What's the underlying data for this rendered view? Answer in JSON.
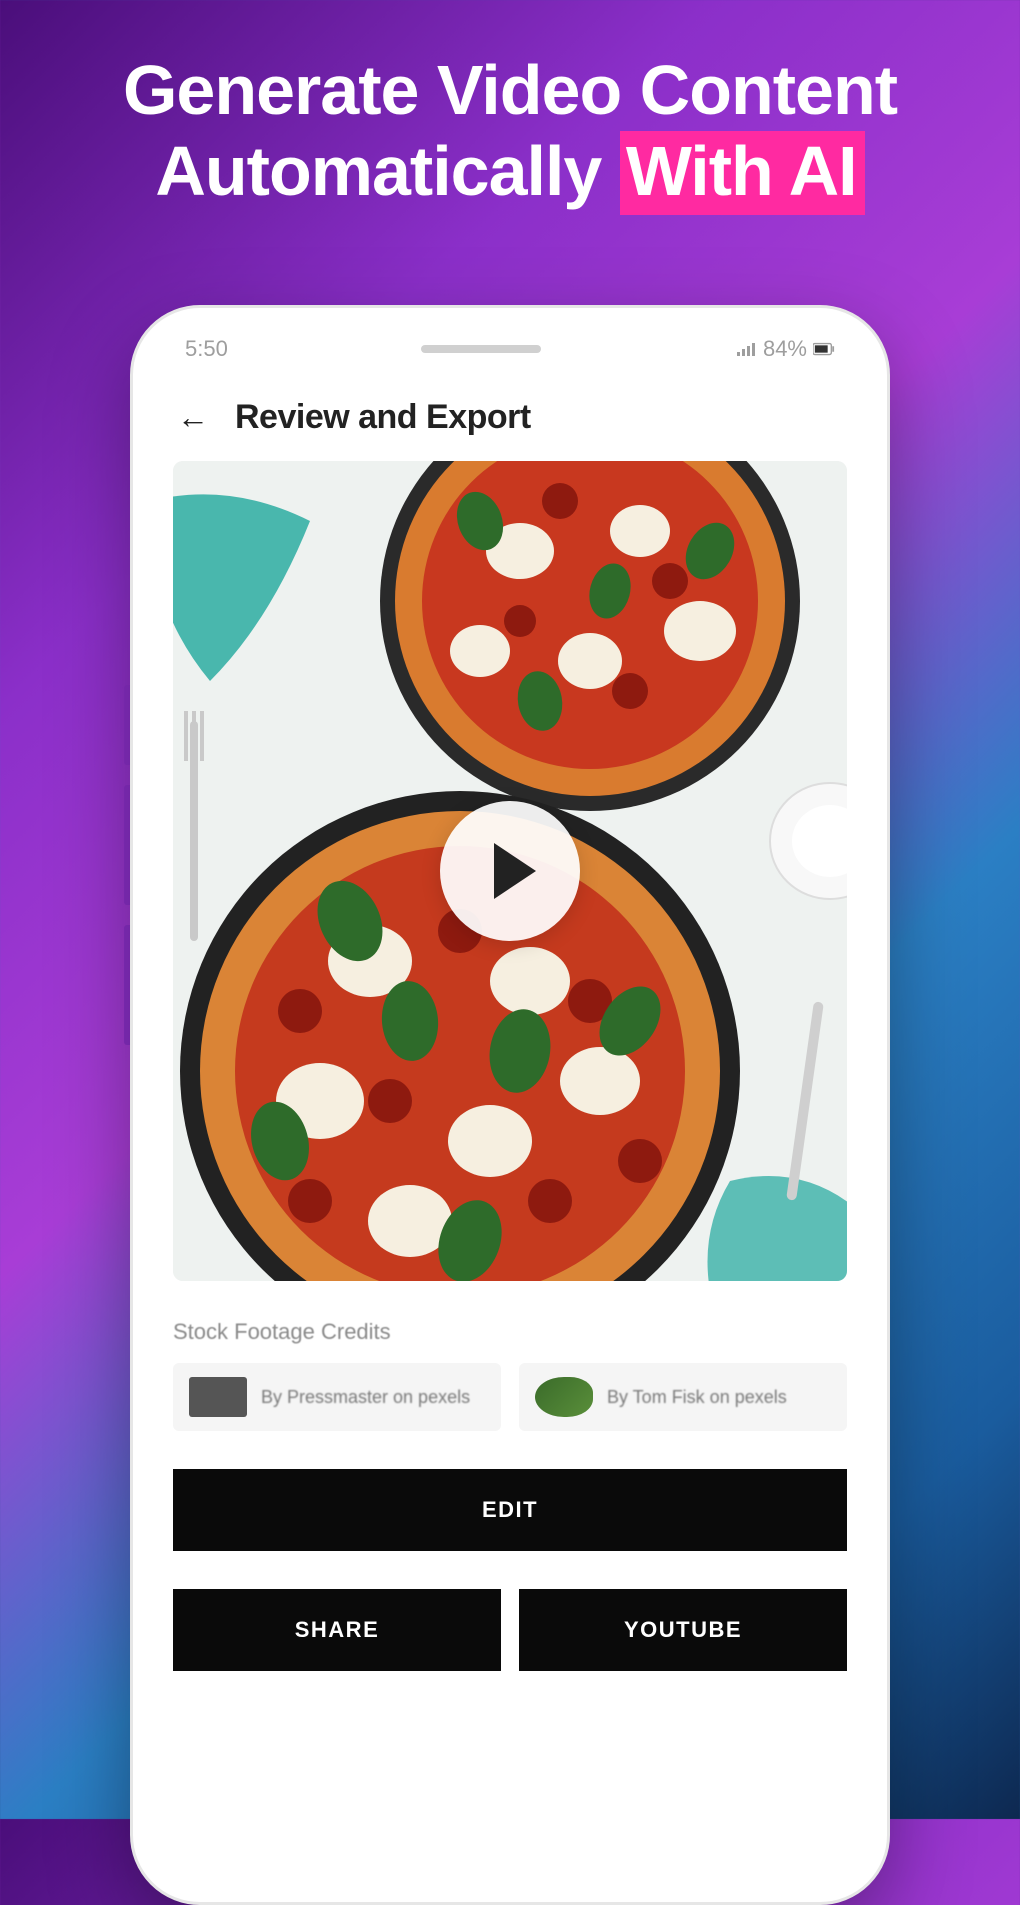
{
  "headline": {
    "line1": "Generate Video Content",
    "line2_plain": "Automatically ",
    "line2_highlight": "With AI"
  },
  "status_bar": {
    "time": "5:50",
    "battery": "84%"
  },
  "app": {
    "back_glyph": "←",
    "title": "Review and Export"
  },
  "play_button_label": "play",
  "credits": {
    "section_label": "Stock Footage Credits",
    "items": [
      {
        "text": "By Pressmaster on pexels"
      },
      {
        "text": "By Tom Fisk on pexels"
      }
    ]
  },
  "buttons": {
    "edit": "EDIT",
    "share": "SHARE",
    "youtube": "YOUTUBE"
  }
}
